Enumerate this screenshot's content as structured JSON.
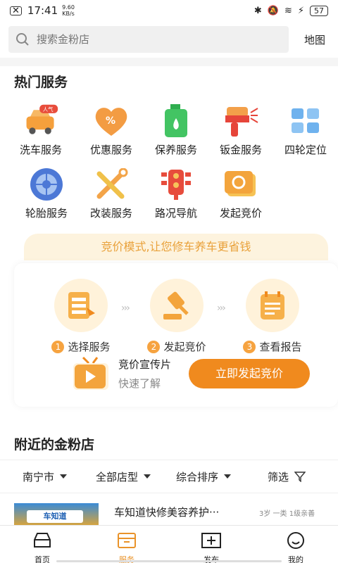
{
  "status_bar": {
    "time": "17:41",
    "speed_value": "9.60",
    "speed_unit": "KB/s",
    "battery": "57"
  },
  "search": {
    "placeholder": "搜索金粉店",
    "map_label": "地图"
  },
  "services": {
    "title": "热门服务",
    "items": [
      {
        "label": "洗车服务",
        "icon": "car-wash-icon",
        "badge": "人气"
      },
      {
        "label": "优惠服务",
        "icon": "discount-heart-icon"
      },
      {
        "label": "保养服务",
        "icon": "oil-can-icon"
      },
      {
        "label": "钣金服务",
        "icon": "spray-gun-icon"
      },
      {
        "label": "四轮定位",
        "icon": "grid-icon"
      },
      {
        "label": "轮胎服务",
        "icon": "tire-icon"
      },
      {
        "label": "改装服务",
        "icon": "wrench-icon"
      },
      {
        "label": "路况导航",
        "icon": "traffic-light-icon"
      },
      {
        "label": "发起竞价",
        "icon": "bid-icon"
      }
    ]
  },
  "bid": {
    "banner": "竞价模式,让您修车养车更省钱",
    "steps": [
      {
        "num": "1",
        "label": "选择服务"
      },
      {
        "num": "2",
        "label": "发起竞价"
      },
      {
        "num": "3",
        "label": "查看报告"
      }
    ],
    "video_title": "竞价宣传片",
    "video_sub": "快速了解",
    "button": "立即发起竞价"
  },
  "nearby": {
    "title": "附近的金粉店",
    "filters": [
      {
        "label": "南宁市"
      },
      {
        "label": "全部店型"
      },
      {
        "label": "综合排序"
      },
      {
        "label": "筛选"
      }
    ],
    "shop": {
      "name": "车知道快修美容养护···",
      "image_text": "车知道",
      "tags": "3岁 一类 1级亲善"
    }
  },
  "tabs": [
    {
      "label": "首页"
    },
    {
      "label": "服务",
      "active": true
    },
    {
      "label": "发布"
    },
    {
      "label": "我的"
    }
  ],
  "colors": {
    "accent": "#f08a1e",
    "banner_bg": "#fdf3de",
    "active_tab": "#e9932a"
  }
}
